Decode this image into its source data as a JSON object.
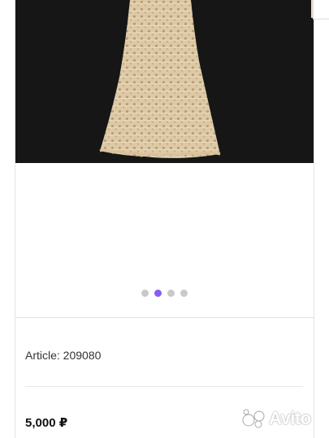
{
  "listing": {
    "article_label": "Article: 209080",
    "price_label": "5,000 ₽"
  },
  "carousel": {
    "photo": "lace-dress-photo",
    "dot_count": 4,
    "active_index": 1,
    "accent_color": "#8a5cf5"
  },
  "watermark": {
    "text": "Avito",
    "icon": "avito-logo-icon"
  }
}
